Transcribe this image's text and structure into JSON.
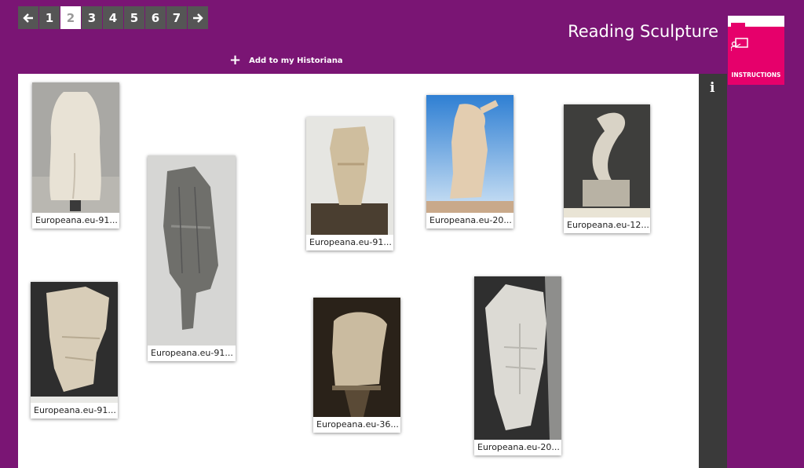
{
  "pagination": {
    "prev_icon": "arrow-left-icon",
    "next_icon": "arrow-right-icon",
    "pages": [
      "1",
      "2",
      "3",
      "4",
      "5",
      "6",
      "7"
    ],
    "active_page": "2"
  },
  "header": {
    "title": "Reading Sculpture",
    "add_label": "Add to my Historiana"
  },
  "instructions": {
    "label": "INSTRUCTIONS",
    "icon": "presentation-user-icon"
  },
  "infobar": {
    "icon": "info-icon",
    "glyph": "i"
  },
  "cards": [
    {
      "caption": "Europeana.eu-91...",
      "image": "marble torso back view on grey"
    },
    {
      "caption": "Europeana.eu-91...",
      "image": "draped figure black and white photo"
    },
    {
      "caption": "Europeana.eu-91...",
      "image": "stone torso on dark base"
    },
    {
      "caption": "Europeana.eu-20...",
      "image": "torso against blue sky"
    },
    {
      "caption": "Europeana.eu-12...",
      "image": "abstract curved sculpture on pedestal"
    },
    {
      "caption": "Europeana.eu-91...",
      "image": "marble torso relief on black"
    },
    {
      "caption": "Europeana.eu-36...",
      "image": "torso sepia photo on dark background"
    },
    {
      "caption": "Europeana.eu-20...",
      "image": "muscular torso black and white"
    }
  ]
}
